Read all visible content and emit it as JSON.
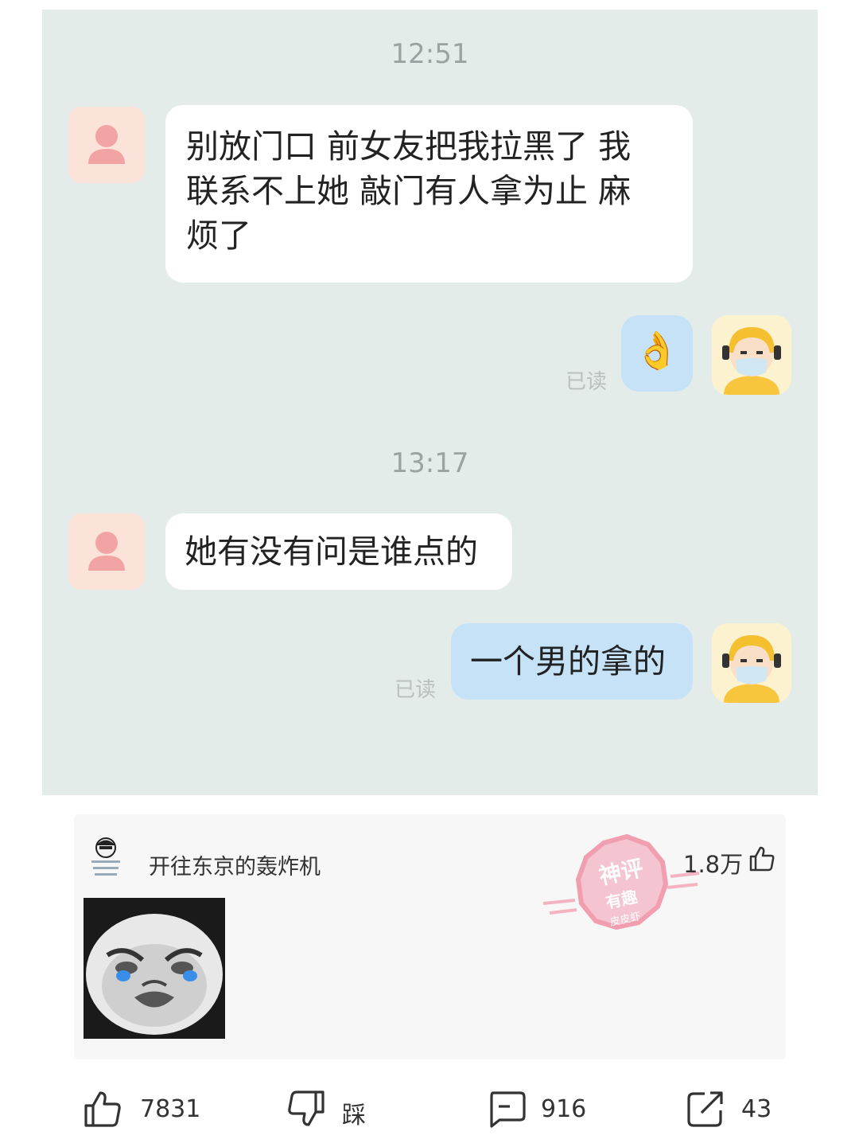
{
  "chat": {
    "time_1": "12:51",
    "msg_1": "别放门口 前女友把我拉黑了 我联系不上她 敲门有人拿为止 麻烦了",
    "msg_1_lines": [
      "别放门口 前女友把我拉黑了 我",
      "联系不上她 敲门有人拿为止 麻",
      "烦了"
    ],
    "reply_1_emoji": "👌",
    "read_1": "已读",
    "time_2": "13:17",
    "msg_2": "她有没有问是谁点的",
    "reply_2": "一个男的拿的",
    "read_2": "已读"
  },
  "comment": {
    "username": "开往东京的轰炸机",
    "likes": "1.8万",
    "stamp_lines": [
      "神评",
      "有趣",
      "皮皮虾"
    ]
  },
  "actions": {
    "like_count": "7831",
    "dislike_label": "踩",
    "comment_count": "916",
    "share_count": "43"
  },
  "colors": {
    "chat_bg": "#e4ecea",
    "incoming_bubble": "#ffffff",
    "outgoing_bubble": "#c6e2f6",
    "user_avatar": "#fbe3da",
    "stamp": "#f08fa4"
  }
}
